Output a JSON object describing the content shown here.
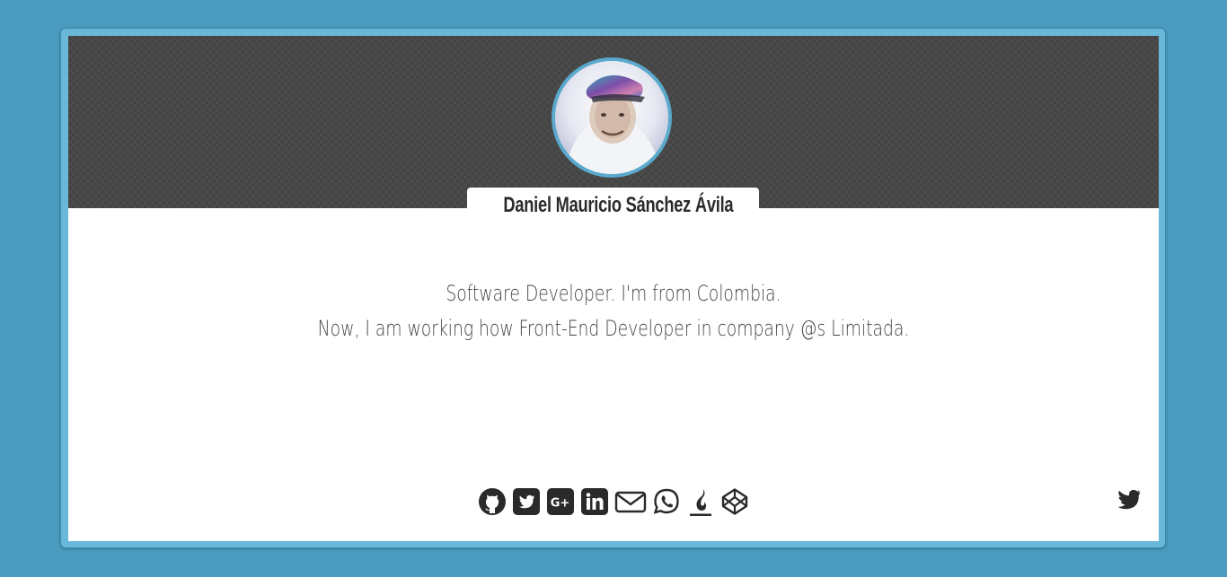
{
  "profile": {
    "name": "Daniel Mauricio Sánchez Ávila",
    "bio_line_1": "Software Developer. I'm from Colombia.",
    "bio_line_2": "Now, I am working how Front-End Developer in company @s Limitada."
  },
  "social_links": [
    {
      "icon": "github-icon"
    },
    {
      "icon": "twitter-square-icon"
    },
    {
      "icon": "google-plus-square-icon"
    },
    {
      "icon": "linkedin-square-icon"
    },
    {
      "icon": "envelope-icon"
    },
    {
      "icon": "whatsapp-icon"
    },
    {
      "icon": "fire-icon"
    },
    {
      "icon": "codepen-icon"
    }
  ],
  "floating": {
    "icon": "twitter-icon"
  },
  "colors": {
    "page_background": "#4a9bbf",
    "frame": "#69b7d9",
    "banner": "#444444",
    "avatar_border": "#5aa9cc",
    "text_dark": "#2a2a2a",
    "text_bio": "#444444"
  }
}
